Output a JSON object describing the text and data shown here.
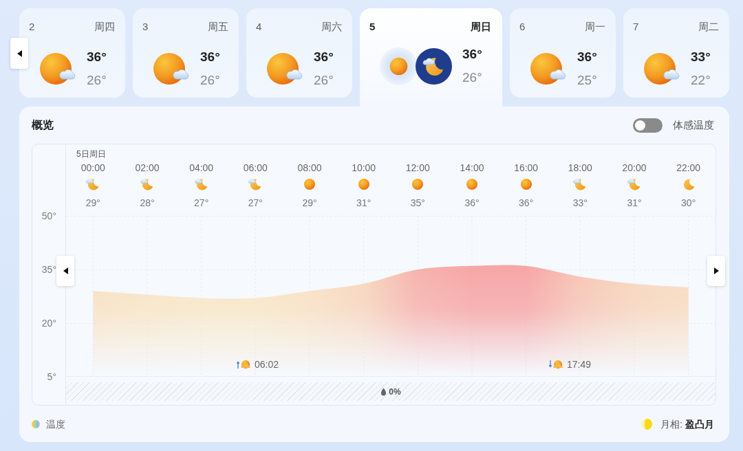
{
  "days": [
    {
      "date": "2",
      "weekday": "周四",
      "kind": "partlycloudy",
      "high": "36°",
      "low": "26°",
      "selected": false
    },
    {
      "date": "3",
      "weekday": "周五",
      "kind": "partlycloudy",
      "high": "36°",
      "low": "26°",
      "selected": false
    },
    {
      "date": "4",
      "weekday": "周六",
      "kind": "partlycloudy",
      "high": "36°",
      "low": "26°",
      "selected": false
    },
    {
      "date": "5",
      "weekday": "周日",
      "kind": "daynight",
      "high": "36°",
      "low": "26°",
      "selected": true
    },
    {
      "date": "6",
      "weekday": "周一",
      "kind": "partlycloudy",
      "high": "36°",
      "low": "25°",
      "selected": false
    },
    {
      "date": "7",
      "weekday": "周二",
      "kind": "partlycloudy",
      "high": "33°",
      "low": "22°",
      "selected": false
    }
  ],
  "overview": {
    "title": "概览",
    "feels_like": {
      "label": "体感温度",
      "on": false
    },
    "hourly": {
      "date_label": "5日周日",
      "hours": [
        {
          "kind": "cloudynight",
          "temp": "29°"
        },
        {
          "kind": "cloudynight",
          "temp": "28°"
        },
        {
          "kind": "cloudynight",
          "temp": "27°"
        },
        {
          "kind": "cloudynight",
          "temp": "27°"
        },
        {
          "kind": "sunny",
          "temp": "29°"
        },
        {
          "kind": "sunny",
          "temp": "31°"
        },
        {
          "kind": "sunny",
          "temp": "35°"
        },
        {
          "kind": "sunny",
          "temp": "36°"
        },
        {
          "kind": "sunny",
          "temp": "36°"
        },
        {
          "kind": "cloudynight",
          "temp": "33°"
        },
        {
          "kind": "cloudynight",
          "temp": "31°"
        },
        {
          "kind": "clearnight",
          "temp": "30°"
        }
      ]
    },
    "chart_data": [
      {
        "type": "area",
        "categories": [
          "00:00",
          "02:00",
          "04:00",
          "06:00",
          "08:00",
          "10:00",
          "12:00",
          "14:00",
          "16:00",
          "18:00",
          "20:00",
          "22:00"
        ],
        "values": [
          29,
          28,
          27,
          27,
          29,
          31,
          35,
          36,
          36,
          33,
          31,
          30
        ],
        "ylim": [
          5,
          70
        ],
        "yticks": [
          {
            "value": 50,
            "label": "50°"
          },
          {
            "value": 35,
            "label": "35°"
          },
          {
            "value": 20,
            "label": "20°"
          },
          {
            "value": 5,
            "label": "5°"
          }
        ],
        "grid": true
      }
    ],
    "sun_events": [
      {
        "kind": "sunrise",
        "time": "06:02"
      },
      {
        "kind": "sunset",
        "time": "17:49"
      }
    ],
    "precipitation": {
      "value": "0%"
    },
    "legend": {
      "label": "温度"
    },
    "moon_phase": "月相: **盈凸月**"
  }
}
